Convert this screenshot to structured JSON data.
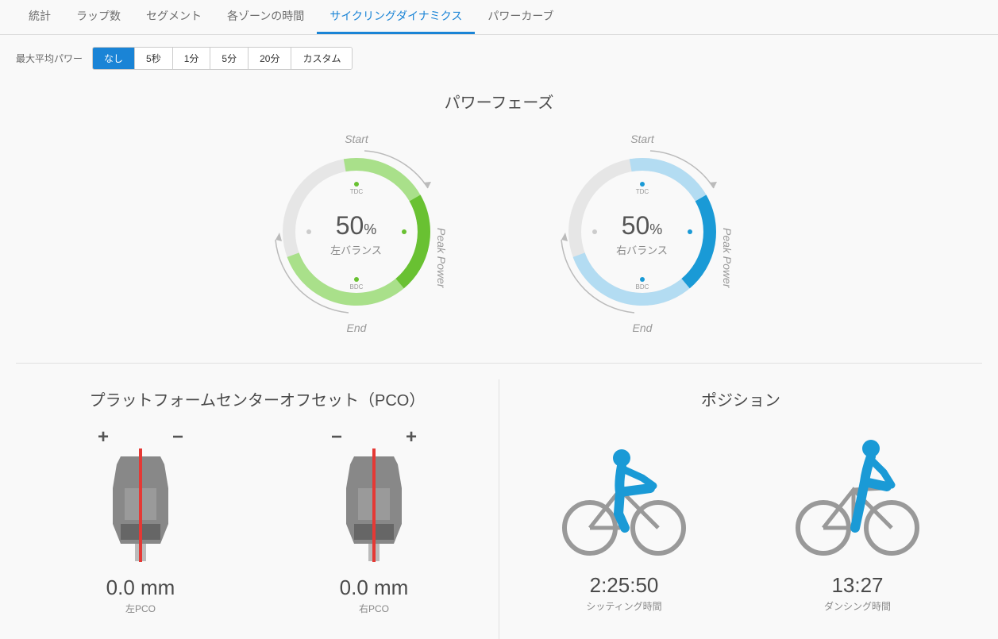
{
  "tabs": {
    "stats": "統計",
    "laps": "ラップ数",
    "segments": "セグメント",
    "zones": "各ゾーンの時間",
    "dynamics": "サイクリングダイナミクス",
    "powercurve": "パワーカーブ"
  },
  "filter": {
    "label": "最大平均パワー",
    "options": {
      "none": "なし",
      "5s": "5秒",
      "1m": "1分",
      "5m": "5分",
      "20m": "20分",
      "custom": "カスタム"
    }
  },
  "powerphase": {
    "title": "パワーフェーズ",
    "start": "Start",
    "end": "End",
    "peak": "Peak Power",
    "tdc": "TDC",
    "bdc": "BDC",
    "left": {
      "value": "50",
      "pct": "%",
      "label": "左バランス"
    },
    "right": {
      "value": "50",
      "pct": "%",
      "label": "右バランス"
    }
  },
  "pco": {
    "title": "プラットフォームセンターオフセット（PCO）",
    "plus": "+",
    "minus": "−",
    "left": {
      "value": "0.0 mm",
      "label": "左PCO"
    },
    "right": {
      "value": "0.0 mm",
      "label": "右PCO"
    }
  },
  "position": {
    "title": "ポジション",
    "seated": {
      "value": "2:25:50",
      "label": "シッティング時間"
    },
    "standing": {
      "value": "13:27",
      "label": "ダンシング時間"
    }
  },
  "chart_data": [
    {
      "type": "pie",
      "title": "左バランス Power Phase",
      "series": [
        {
          "name": "Power Phase",
          "start_deg": 350,
          "end_deg": 200,
          "color": "#a9e08a"
        },
        {
          "name": "Peak Power",
          "start_deg": 60,
          "end_deg": 140,
          "color": "#69c132"
        }
      ],
      "center_value": 50,
      "center_unit": "%"
    },
    {
      "type": "pie",
      "title": "右バランス Power Phase",
      "series": [
        {
          "name": "Power Phase",
          "start_deg": 350,
          "end_deg": 200,
          "color": "#b3dcf2"
        },
        {
          "name": "Peak Power",
          "start_deg": 60,
          "end_deg": 140,
          "color": "#1a9ad6"
        }
      ],
      "center_value": 50,
      "center_unit": "%"
    }
  ]
}
